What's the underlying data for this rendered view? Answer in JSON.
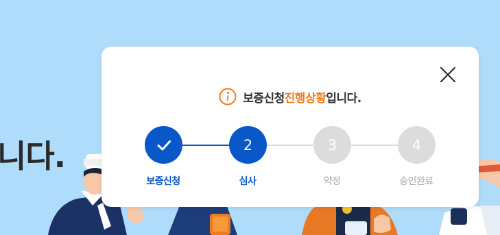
{
  "background": {
    "heading_fragment": "니다."
  },
  "modal": {
    "message": {
      "icon": "info-icon",
      "prefix": "보증신청 ",
      "highlight": "진행상황",
      "suffix": "입니다."
    },
    "close_icon": "close-icon",
    "steps": [
      {
        "number": "",
        "icon": "check-icon",
        "label": "보증신청",
        "status": "completed"
      },
      {
        "number": "2",
        "label": "심사",
        "status": "current"
      },
      {
        "number": "3",
        "label": "약정",
        "status": "pending"
      },
      {
        "number": "4",
        "label": "승인완료",
        "status": "pending"
      }
    ]
  },
  "colors": {
    "background": "#b0dcfb",
    "active": "#0a57c9",
    "pending": "#dcdcdc",
    "pending_text": "#a8a8a8",
    "highlight": "#ee7d1b"
  }
}
